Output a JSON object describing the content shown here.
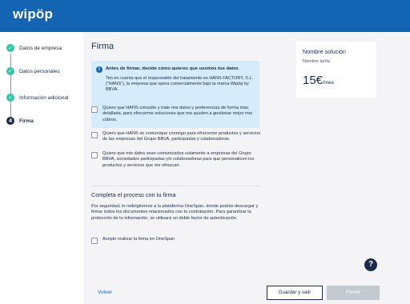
{
  "brand": {
    "logo_text": "wipöp"
  },
  "sidebar": {
    "steps": [
      {
        "label": "Datos de empresa",
        "state": "done",
        "marker": "✓"
      },
      {
        "label": "Datos personales",
        "state": "done",
        "marker": "✓"
      },
      {
        "label": "Información adicional",
        "state": "done",
        "marker": "✓"
      },
      {
        "label": "Firma",
        "state": "current",
        "marker": "4"
      }
    ]
  },
  "main": {
    "title": "Firma",
    "info": {
      "icon": "info-icon",
      "title": "Antes de firmar, decide cómo quieres que usemos tus datos",
      "text": "Ten en cuenta que el responsable del tratamiento es HANS FACTORY, S.L. (\"HANS\"), la empresa que opera comercialmente bajo la marca Wipöp by BBVA."
    },
    "consents": [
      {
        "text": "Quiero que HANS consulte y trate mis datos y preferencias de forma más detallada, para ofrecerme soluciones que me ayuden a gestionar mejor mis cobros.",
        "checked": false
      },
      {
        "text": "Quiero que HANS se comunique conmigo para ofrecerme productos y servicios de las empresas del Grupo BBVA, participadas y colaboradoras.",
        "checked": false
      },
      {
        "text": "Quiero que mis datos sean comunicados solamente a empresas del Grupo BBVA, sociedades participadas y/o colaboradoras para que personalicen los productos y servicios que me ofrezcan.",
        "checked": false
      }
    ],
    "process": {
      "title": "Completa el proceso con tu firma",
      "text": "Por seguridad, te redirigiremos a la plataforma OneSpan, donde podrás descargar y firmar todos los documentos relacionados con tu contratación. Para garantizar la protección de tu información, se utilizará un doble factor de autenticación.",
      "accept_label": "Acepto realizar la firma en OneSpan",
      "accept_checked": false
    }
  },
  "summary": {
    "title": "Nombre solución",
    "subtitle": "Nombre tarifa",
    "price": "15€",
    "period": "/mes"
  },
  "help": {
    "label": "?"
  },
  "footer": {
    "back_label": "Volver",
    "save_label": "Guardar y salir",
    "sign_label": "Firmar"
  },
  "colors": {
    "header": "#1464b4",
    "step_done": "#34c3a4",
    "info_bg": "#d7ecfa",
    "navy": "#1a2a4a",
    "disabled_button": "#c4c8cf"
  }
}
